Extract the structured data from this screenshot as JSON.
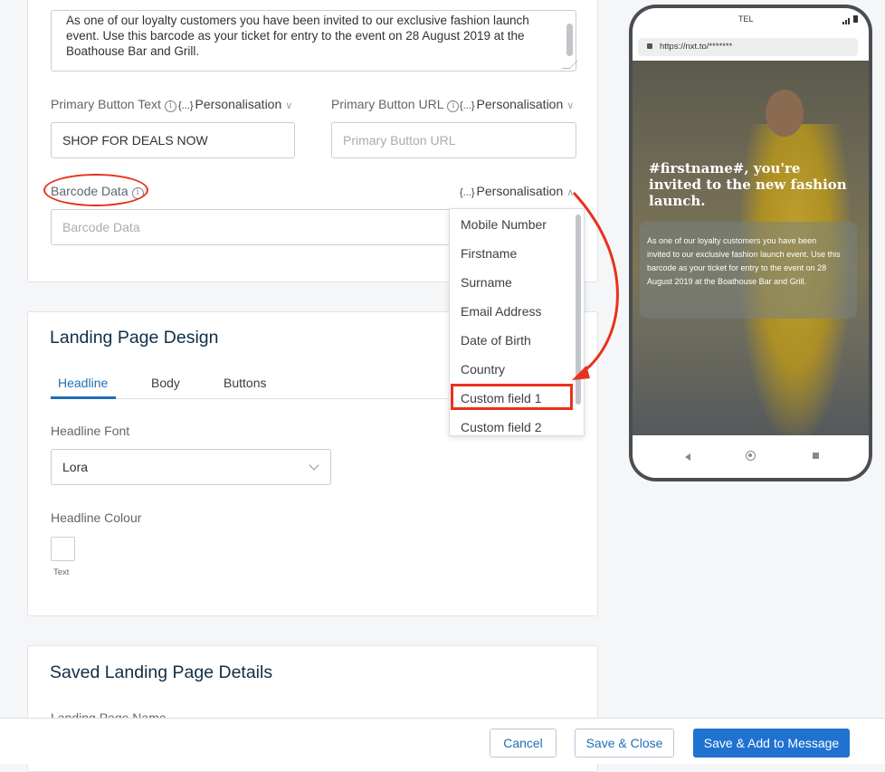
{
  "message_card": {
    "message_text": "As one of our loyalty customers you have been invited to our exclusive fashion launch event. Use this barcode as your ticket for entry to the event on 28 August 2019 at the Boathouse Bar and Grill.",
    "primary_button_text_label": "Primary Button Text",
    "primary_button_text_value": "SHOP FOR DEALS NOW",
    "primary_button_url_label": "Primary Button URL",
    "primary_button_url_placeholder": "Primary Button URL",
    "personalisation_label": "Personalisation",
    "personalisation_braces": "{...}",
    "info_glyph": "i",
    "barcode_label": "Barcode Data",
    "barcode_placeholder": "Barcode Data"
  },
  "personalisation_menu": {
    "options": [
      "Mobile Number",
      "Firstname",
      "Surname",
      "Email Address",
      "Date of Birth",
      "Country",
      "Custom field 1",
      "Custom field 2"
    ],
    "highlighted": "Custom field 1"
  },
  "landing_design": {
    "title": "Landing Page Design",
    "tabs": [
      "Headline",
      "Body",
      "Buttons"
    ],
    "active_tab": "Headline",
    "font_label": "Headline Font",
    "font_value": "Lora",
    "colour_label": "Headline Colour",
    "swatch_label": "Text",
    "swatch_color": "#ffffff"
  },
  "saved_details": {
    "title": "Saved Landing Page Details",
    "name_label": "Landing Page Name"
  },
  "footer": {
    "cancel": "Cancel",
    "save_close": "Save & Close",
    "save_add": "Save & Add to Message"
  },
  "phone_preview": {
    "carrier": "TEL",
    "url": "https://nxt.to/*******",
    "headline": "#firstname#, you're invited to the new fashion launch.",
    "body": "As one of our loyalty customers you have been invited to our exclusive fashion launch event. Use this barcode as your ticket for entry to the event on 28 August 2019 at the Boathouse Bar and Grill."
  },
  "colors": {
    "accent": "#1f72d0",
    "annotation_red": "#e8321c",
    "heading": "#0f2e47"
  }
}
